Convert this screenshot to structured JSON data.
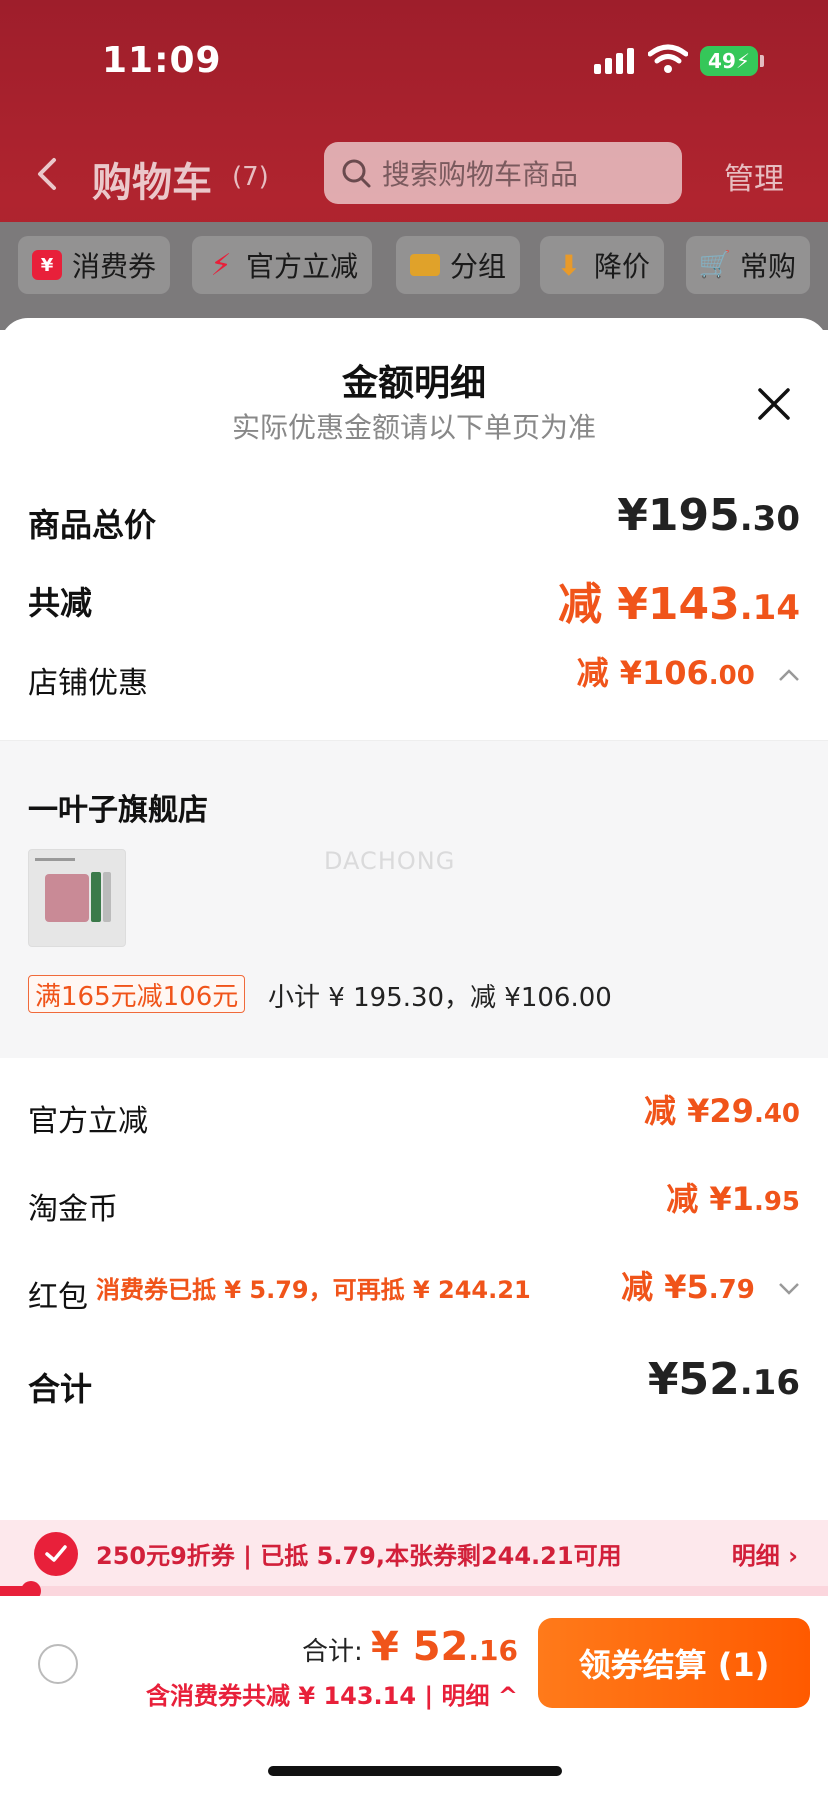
{
  "status": {
    "time": "11:09",
    "battery": "49"
  },
  "header": {
    "title": "购物车",
    "count": "(7)",
    "search_placeholder": "搜索购物车商品",
    "manage": "管理"
  },
  "filters": [
    {
      "label": "消费券",
      "icon": "coupon-icon"
    },
    {
      "label": "官方立减",
      "icon": "lightning-icon"
    },
    {
      "label": "分组",
      "icon": "folder-icon"
    },
    {
      "label": "降价",
      "icon": "price-drop-icon"
    },
    {
      "label": "常购",
      "icon": "cart-icon"
    }
  ],
  "sheet": {
    "title": "金额明细",
    "subtitle": "实际优惠金额请以下单页为准",
    "rows": {
      "total_price": {
        "label": "商品总价",
        "value_main": "¥195",
        "value_dec": ".30"
      },
      "total_discount": {
        "label": "共减",
        "value_main": "减 ¥143",
        "value_dec": ".14"
      },
      "store_discount": {
        "label": "店铺优惠",
        "value_main": "减 ¥106",
        "value_dec": ".00"
      },
      "official_discount": {
        "label": "官方立减",
        "value_main": "减 ¥29",
        "value_dec": ".40"
      },
      "taojin": {
        "label": "淘金币",
        "value_main": "减 ¥1",
        "value_dec": ".95"
      },
      "hongbao": {
        "label": "红包",
        "note": "消费券已抵 ¥ 5.79，可再抵 ¥ 244.21",
        "value_main": "减 ¥5",
        "value_dec": ".79"
      },
      "sum": {
        "label": "合计",
        "value_main": "¥52",
        "value_dec": ".16"
      }
    },
    "store": {
      "name": "一叶子旗舰店",
      "watermark": "DACHONG",
      "promo_tag": "满165元减106元",
      "subtotal": "小计 ¥ 195.30，减 ¥106.00"
    }
  },
  "coupon_bar": {
    "text": "250元9折券 | 已抵 5.79,本张券剩244.21可用",
    "detail": "明细 ›",
    "progress": 0.03
  },
  "bottom": {
    "total_label": "合计: ",
    "total_main": "¥ 52",
    "total_dec": ".16",
    "saving": "含消费券共减 ¥ 143.14 | 明细 ^",
    "checkout": "领券结算 (1)"
  }
}
